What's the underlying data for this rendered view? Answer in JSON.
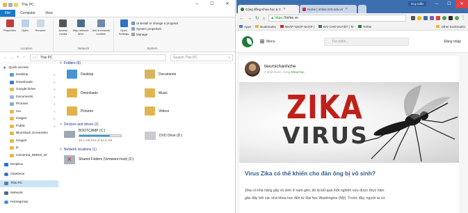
{
  "explorer": {
    "title": "This PC",
    "window_controls": [
      "─",
      "☐",
      "✕"
    ],
    "tabs": [
      "File",
      "Computer",
      "View"
    ],
    "ribbon": {
      "location_group": "Location",
      "network_group": "Network",
      "system_group": "System",
      "properties": "Properties",
      "open": "Open",
      "rename": "Rename",
      "access_media": "Access media",
      "map_network_drive": "Map network drive",
      "add_network_location": "Add a network location",
      "open_settings": "Open Settings",
      "uninstall": "Uninstall or change a program",
      "system_properties": "System properties",
      "manage": "Manage"
    },
    "address": {
      "path": "This PC",
      "search_placeholder": "Search This PC"
    },
    "nav": {
      "quick_access": "Quick access",
      "items": [
        "Desktop",
        "Downloads",
        "Google Drive",
        "Documents",
        "Pictures",
        "xxx",
        "images",
        "Public",
        "BlueStack Screensho",
        "images",
        "js",
        "Universal_NMNG_W"
      ],
      "dropbox": "Dropbox",
      "onedrive": "OneDrive",
      "this_pc": "This PC",
      "network": "Network",
      "homegroup": "Homegroup"
    },
    "folders_header": "Folders (6)",
    "folders": [
      "Desktop",
      "Documents",
      "Downloads",
      "Music",
      "Pictures",
      "Videos"
    ],
    "devices_header": "Devices and drives (2)",
    "drive_c": {
      "name": "BOOTCAMP (C:)",
      "free": "25.4 GB free of 92.6 GB",
      "used_fraction": 0.726
    },
    "drive_d": {
      "name": "DVD Drive (D:)"
    },
    "netloc_header": "Network locations (1)",
    "shared_folder": "Shared Folders (\\\\vmware-host) (Z:)"
  },
  "chrome": {
    "profile": "Duy tuấn",
    "tabs": [
      "Cộng đồng Khoa học & C",
      "Home | online.nmt.edu.vn"
    ],
    "url_https": "https://",
    "url_rest": "tinhte.vn",
    "bookmarks": [
      "Apps",
      "Bookmarks",
      "NHẬP NHẬP NHẬP |",
      "BÀI CHỜ DUYỆT | Tir",
      "Tinhte"
    ],
    "other_bookmarks": "Other bookmarks",
    "site": {
      "menu": "Menu",
      "search_placeholder": "Tìm kiếm...",
      "login": "Đăng nhập"
    },
    "article": {
      "author": "tieumichanhche",
      "meta_prefix": "2 phút trước, trong",
      "category": "Khoa học",
      "hero_word1": "ZIKA",
      "hero_word2": "VIRUS",
      "headline": "Virus Zika có thể khiến cho đàn ông bị vô sinh?",
      "para1": "Zika có khả năng gây vô sinh ở nam giới, đó là kết quả một nghiên cứu được thực hiện",
      "para2": "gần đây bởi các nhà khoa học đến từ Đại học Washington (Mỹ). Trước đây, người ta cứ"
    }
  },
  "colors": {
    "chrome_title": "#3d6fb0",
    "ribbon_file": "#1979ca",
    "drive_bar": "#26a0da",
    "headline": "#2f5b8f",
    "zika": "#c0201a"
  }
}
